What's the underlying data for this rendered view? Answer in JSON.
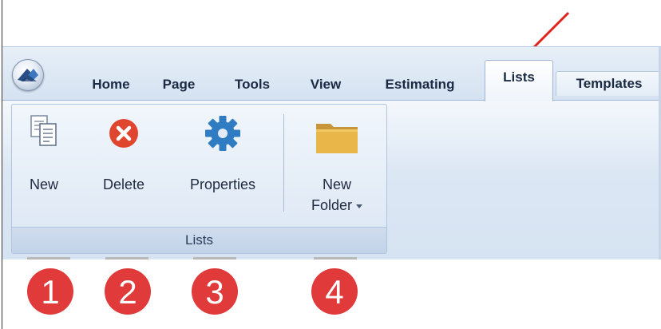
{
  "tabs": [
    {
      "label": "Home"
    },
    {
      "label": "Page"
    },
    {
      "label": "Tools"
    },
    {
      "label": "View"
    },
    {
      "label": "Estimating"
    },
    {
      "label": "Lists",
      "active": true
    },
    {
      "label": "Templates"
    }
  ],
  "ribbon": {
    "group_label": "Lists",
    "buttons": {
      "new": {
        "label": "New",
        "icon": "new-document-icon"
      },
      "delete": {
        "label": "Delete",
        "icon": "delete-icon"
      },
      "properties": {
        "label": "Properties",
        "icon": "gear-icon"
      },
      "new_folder": {
        "label_line1": "New",
        "label_line2": "Folder",
        "icon": "folder-icon",
        "has_dropdown": true
      }
    }
  },
  "callouts": [
    "1",
    "2",
    "3",
    "4"
  ],
  "colors": {
    "callout": "#e03a3a",
    "delete_icon": "#e0452e",
    "gear_icon": "#2f7cc2",
    "folder_icon": "#e9b649",
    "arrow": "#e0201a"
  }
}
